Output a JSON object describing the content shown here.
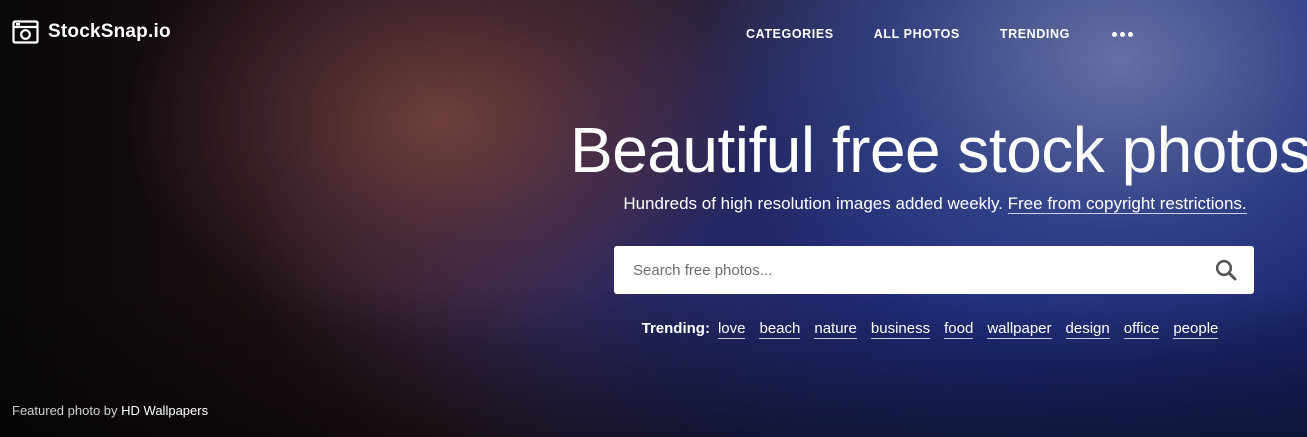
{
  "brand": {
    "name": "StockSnap.io",
    "logo_icon": "camera-icon"
  },
  "nav": {
    "items": [
      {
        "label": "CATEGORIES"
      },
      {
        "label": "ALL PHOTOS"
      },
      {
        "label": "TRENDING"
      }
    ],
    "more_icon": "more-dots-icon"
  },
  "hero": {
    "headline": "Beautiful free stock photos",
    "subline_text": "Hundreds of high resolution images added weekly.",
    "subline_link": "Free from copyright restrictions."
  },
  "search": {
    "placeholder": "Search free photos...",
    "value": "",
    "icon": "search-icon"
  },
  "trending": {
    "label": "Trending:",
    "tags": [
      "love",
      "beach",
      "nature",
      "business",
      "food",
      "wallpaper",
      "design",
      "office",
      "people"
    ]
  },
  "credit": {
    "prefix": "Featured photo by",
    "author": "HD Wallpapers"
  },
  "colors": {
    "text": "#ffffff",
    "search_bg": "#ffffff",
    "search_icon": "#555555",
    "placeholder": "#6d6d6d"
  }
}
